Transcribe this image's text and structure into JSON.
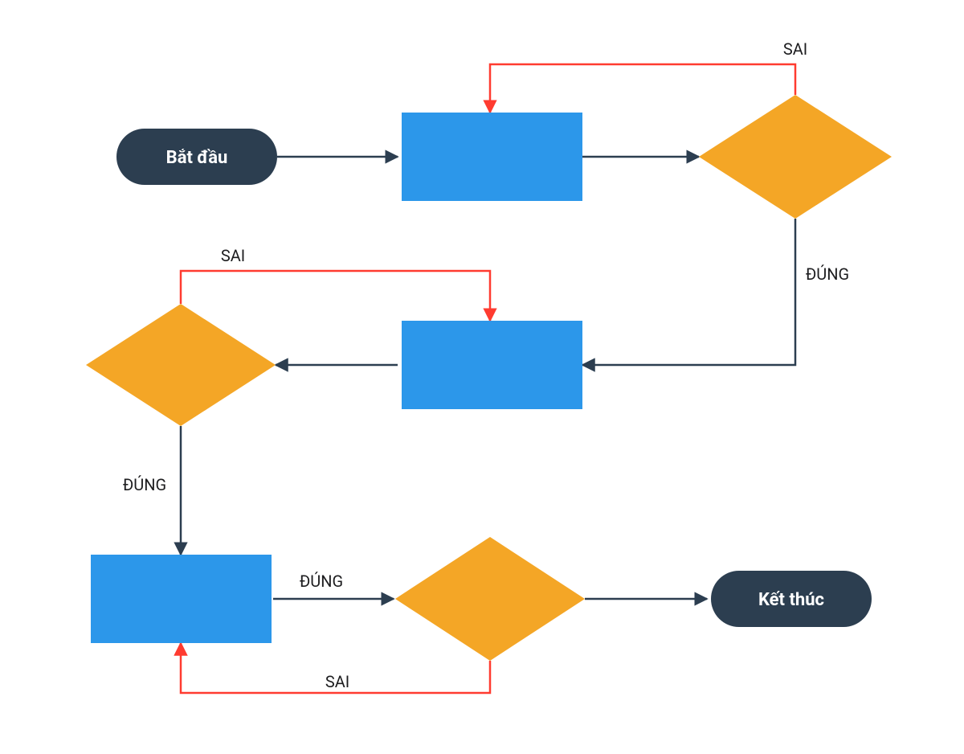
{
  "diagram": {
    "nodes": {
      "start": {
        "type": "terminator",
        "label": "Bắt đầu"
      },
      "end": {
        "type": "terminator",
        "label": "Kết thúc"
      },
      "p1": {
        "type": "process",
        "label": ""
      },
      "p2": {
        "type": "process",
        "label": ""
      },
      "p3": {
        "type": "process",
        "label": ""
      },
      "d1": {
        "type": "decision",
        "label": ""
      },
      "d2": {
        "type": "decision",
        "label": ""
      },
      "d3": {
        "type": "decision",
        "label": ""
      }
    },
    "edges": [
      {
        "from": "start",
        "to": "p1",
        "label": ""
      },
      {
        "from": "p1",
        "to": "d1",
        "label": ""
      },
      {
        "from": "d1",
        "to": "p2",
        "label": "ĐÚNG",
        "branch": "true"
      },
      {
        "from": "d1",
        "to": "p1",
        "label": "SAI",
        "branch": "false"
      },
      {
        "from": "p2",
        "to": "d2",
        "label": ""
      },
      {
        "from": "d2",
        "to": "p3",
        "label": "ĐÚNG",
        "branch": "true"
      },
      {
        "from": "d2",
        "to": "p2",
        "label": "SAI",
        "branch": "false"
      },
      {
        "from": "p3",
        "to": "d3",
        "label": "ĐÚNG",
        "branch": "true"
      },
      {
        "from": "d3",
        "to": "end",
        "label": "",
        "branch": "true"
      },
      {
        "from": "d3",
        "to": "p3",
        "label": "SAI",
        "branch": "false"
      }
    ],
    "labels": {
      "true": "ĐÚNG",
      "false": "SAI"
    },
    "colors": {
      "terminator": "#2c3e50",
      "process": "#2c97ea",
      "decision": "#f4a626",
      "edge": "#2c3e50",
      "edgeFalse": "#ff3b30"
    }
  }
}
